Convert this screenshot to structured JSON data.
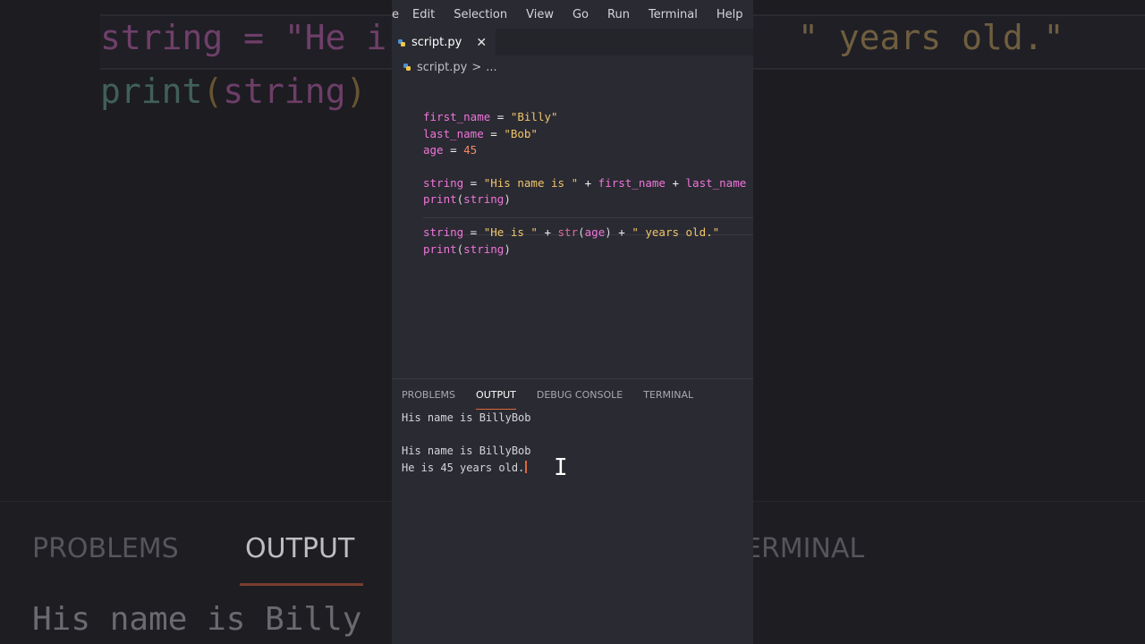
{
  "menu": [
    "e",
    "Edit",
    "Selection",
    "View",
    "Go",
    "Run",
    "Terminal",
    "Help"
  ],
  "tab": {
    "filename": "script.py",
    "close": "✕"
  },
  "breadcrumb": {
    "file": "script.py",
    "chevron": ">",
    "more": "..."
  },
  "code": {
    "l1": {
      "var": "first_name",
      "op": " = ",
      "str": "\"Billy\""
    },
    "l2": {
      "var": "last_name",
      "op": " = ",
      "str": "\"Bob\""
    },
    "l3": {
      "var": "age",
      "op": " = ",
      "num": "45"
    },
    "l5": {
      "var": "string",
      "op": " = ",
      "str": "\"His name is \"",
      "plus1": " + ",
      "v2": "first_name",
      "plus2": " + ",
      "v3": "last_name"
    },
    "l6": {
      "fn": "print",
      "open": "(",
      "arg": "string",
      "close": ")"
    },
    "l8": {
      "var": "string",
      "op": " = ",
      "str1": "\"He is \"",
      "plus1": " + ",
      "fn": "str",
      "open": "(",
      "arg": "age",
      "close": ")",
      "plus2": " + ",
      "str2": "\" years old.\""
    },
    "l9": {
      "fn": "print",
      "open": "(",
      "arg": "string",
      "close": ")"
    }
  },
  "panel": {
    "tabs": [
      "PROBLEMS",
      "OUTPUT",
      "DEBUG CONSOLE",
      "TERMINAL"
    ],
    "active_tab": "OUTPUT",
    "output": [
      "His name is BillyBob",
      "",
      "His name is BillyBob",
      "He is 45 years old."
    ]
  },
  "background": {
    "line1a": "string = \"He i",
    "line1b": "\" years old.\"",
    "line2": "print(string)",
    "tabs": [
      "PROBLEMS",
      "OUTPUT",
      "ERMINAL"
    ],
    "output": "His name is Billy"
  },
  "colors": {
    "variable": "#f075d9",
    "string": "#f0c56a",
    "number": "#f08a6a",
    "accent": "#e0673a"
  }
}
